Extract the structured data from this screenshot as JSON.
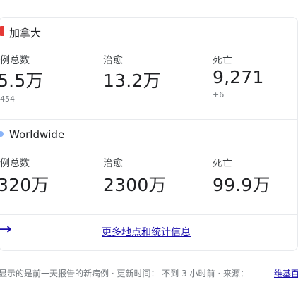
{
  "regions": [
    {
      "name": "加拿大",
      "stats": [
        {
          "label": "例总数",
          "value": "5.5万",
          "sub": "454"
        },
        {
          "label": "治愈",
          "value": "13.2万",
          "sub": ""
        },
        {
          "label": "死亡",
          "value": "9,271",
          "sub": "+6"
        }
      ]
    },
    {
      "name": "Worldwide",
      "stats": [
        {
          "label": "例总数",
          "value": "320万",
          "sub": ""
        },
        {
          "label": "治愈",
          "value": "2300万",
          "sub": ""
        },
        {
          "label": "死亡",
          "value": "99.9万",
          "sub": ""
        }
      ]
    }
  ],
  "more_link": {
    "text": "更多地点和统计信息",
    "icon": "arrow-right-icon"
  },
  "footer": {
    "text": "显示的是前一天报告的新病例 · 更新时间： 不到 3 小时前 · 来源：",
    "link_text": "维基百"
  },
  "colors": {
    "flag": "#e53935",
    "link": "#1a0dab",
    "divider": "#e8eaed"
  }
}
